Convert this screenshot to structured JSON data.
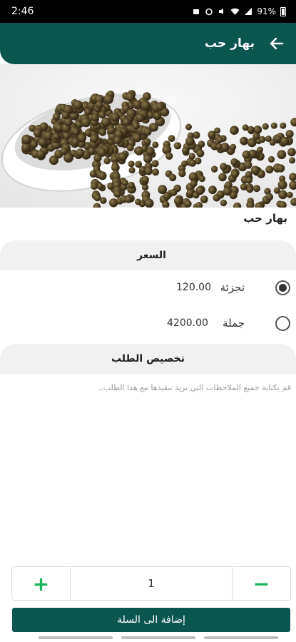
{
  "status_bar": {
    "time": "2:46",
    "battery": "91%"
  },
  "app_bar": {
    "title": "بهار حب",
    "back_icon": "arrow-right-icon"
  },
  "product": {
    "name": "بهار حب",
    "image": "allspice-bowl-photo"
  },
  "price_section": {
    "title": "السعر",
    "options": [
      {
        "label": "تجزئة",
        "price": "120.00",
        "selected": true
      },
      {
        "label": "جملة",
        "price": "4200.00",
        "selected": false
      }
    ]
  },
  "customize_section": {
    "title": "تخصيص الطلب",
    "notes_placeholder": "قم بكتابة جميع الملاحظات التي تريد تنفيذها مع هذا الطلب.."
  },
  "quantity": {
    "value": "1",
    "plus": "+",
    "minus": "−"
  },
  "add_to_cart": "إضافة الى السلة",
  "colors": {
    "primary": "#0c5652",
    "accent": "#17b55a"
  }
}
